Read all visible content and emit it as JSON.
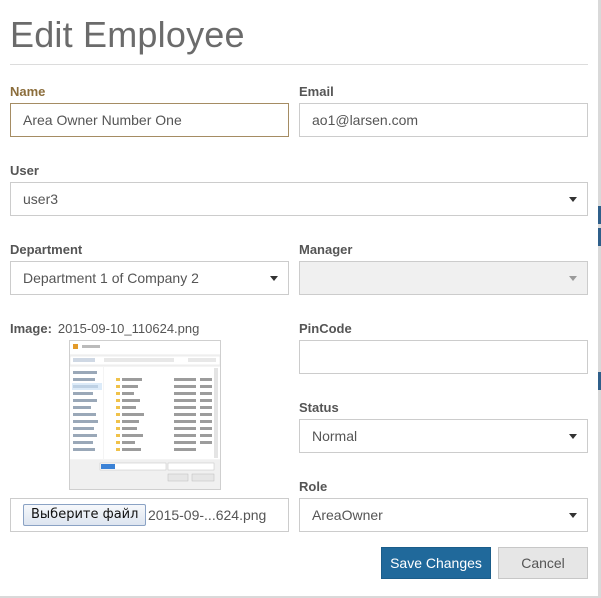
{
  "dialog": {
    "title": "Edit Employee"
  },
  "form": {
    "name": {
      "label": "Name",
      "value": "Area Owner Number One"
    },
    "email": {
      "label": "Email",
      "value": "ao1@larsen.com"
    },
    "user": {
      "label": "User",
      "value": "user3"
    },
    "department": {
      "label": "Department",
      "value": "Department 1 of Company 2"
    },
    "manager": {
      "label": "Manager",
      "value": ""
    },
    "image": {
      "label": "Image:",
      "current_file": "2015-09-10_110624.png",
      "choose_button": "Выберите файл",
      "chosen_file": "2015-09-...624.png"
    },
    "pincode": {
      "label": "PinCode",
      "value": ""
    },
    "status": {
      "label": "Status",
      "value": "Normal"
    },
    "role": {
      "label": "Role",
      "value": "AreaOwner"
    }
  },
  "buttons": {
    "save": "Save Changes",
    "cancel": "Cancel"
  },
  "colors": {
    "primary": "#20699b",
    "focus_label": "#8b6d3b",
    "focus_border": "#a58c63"
  }
}
